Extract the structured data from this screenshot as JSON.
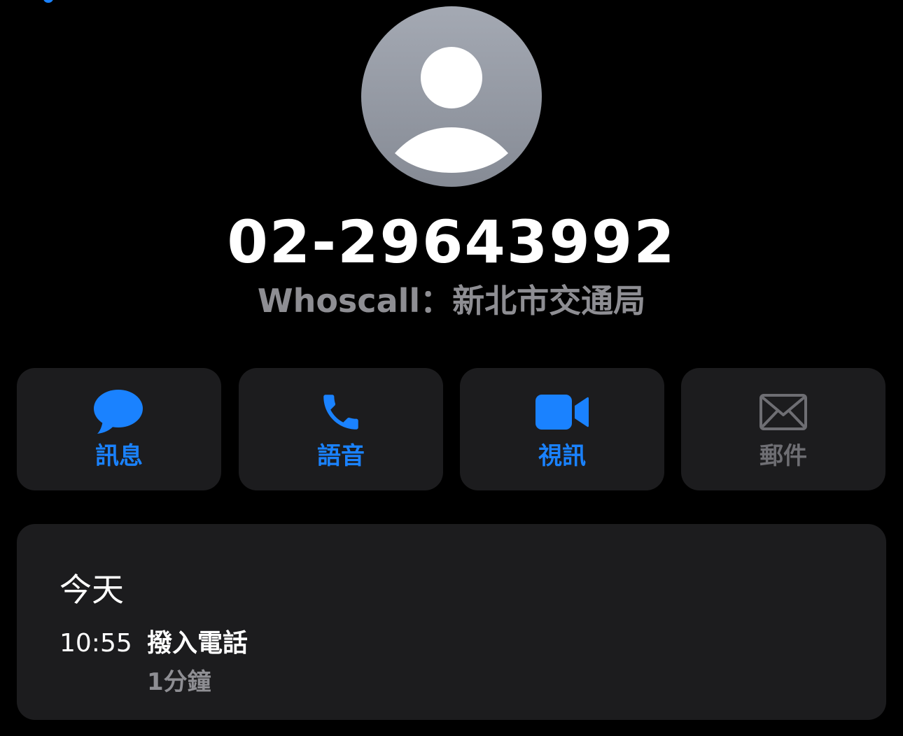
{
  "contact": {
    "avatar_icon": "person-silhouette-icon",
    "phone_number": "02-29643992",
    "caller_id": "Whoscall：新北市交通局"
  },
  "actions": [
    {
      "label": "訊息",
      "icon": "message-bubble-icon",
      "enabled": true
    },
    {
      "label": "語音",
      "icon": "phone-icon",
      "enabled": true
    },
    {
      "label": "視訊",
      "icon": "video-camera-icon",
      "enabled": true
    },
    {
      "label": "郵件",
      "icon": "envelope-icon",
      "enabled": false
    }
  ],
  "history": {
    "date_header": "今天",
    "entries": [
      {
        "time": "10:55",
        "type": "撥入電話",
        "duration": "1分鐘"
      }
    ]
  },
  "colors": {
    "background": "#000000",
    "card": "#1c1c1e",
    "accent": "#1a82ff",
    "secondary_text": "#8e8e93",
    "disabled": "#6e6e73"
  }
}
